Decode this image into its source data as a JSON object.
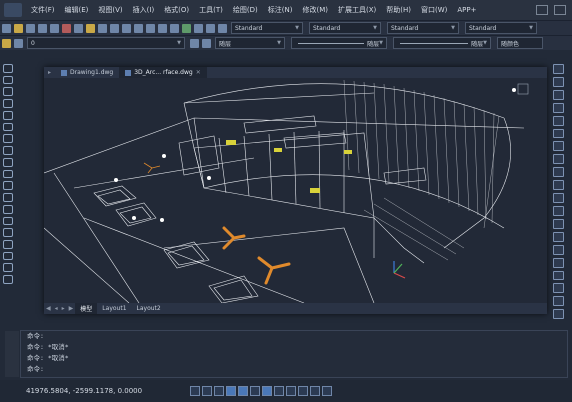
{
  "menu": {
    "items": [
      "文件(F)",
      "编辑(E)",
      "视图(V)",
      "插入(I)",
      "格式(O)",
      "工具(T)",
      "绘图(D)",
      "标注(N)",
      "修改(M)",
      "扩展工具(X)",
      "帮助(H)",
      "窗口(W)",
      "APP+"
    ]
  },
  "toolbar1": {
    "style_combos": [
      "Standard",
      "Standard",
      "Standard",
      "Standard"
    ]
  },
  "toolbar2": {
    "layer_value": "0",
    "color_value": "随层",
    "linetype_value": "随层",
    "lineweight_value": "随层",
    "plotstyle_value": "随颜色"
  },
  "drawing_tabs": [
    {
      "label": "Drawing1.dwg"
    },
    {
      "label": "3D_Arc... rface.dwg"
    }
  ],
  "layout_tabs": [
    "模型",
    "Layout1",
    "Layout2"
  ],
  "command": {
    "lines": [
      "命令:",
      "命令: *取消*",
      "命令: *取消*",
      "命令:"
    ]
  },
  "status": {
    "coords": "41976.5804, -2599.1178, 0.0000"
  },
  "colors": {
    "accent": "#4a78b8",
    "wire": "#e6e9ee",
    "orange": "#e08a2c",
    "yellow": "#d8d23a"
  }
}
